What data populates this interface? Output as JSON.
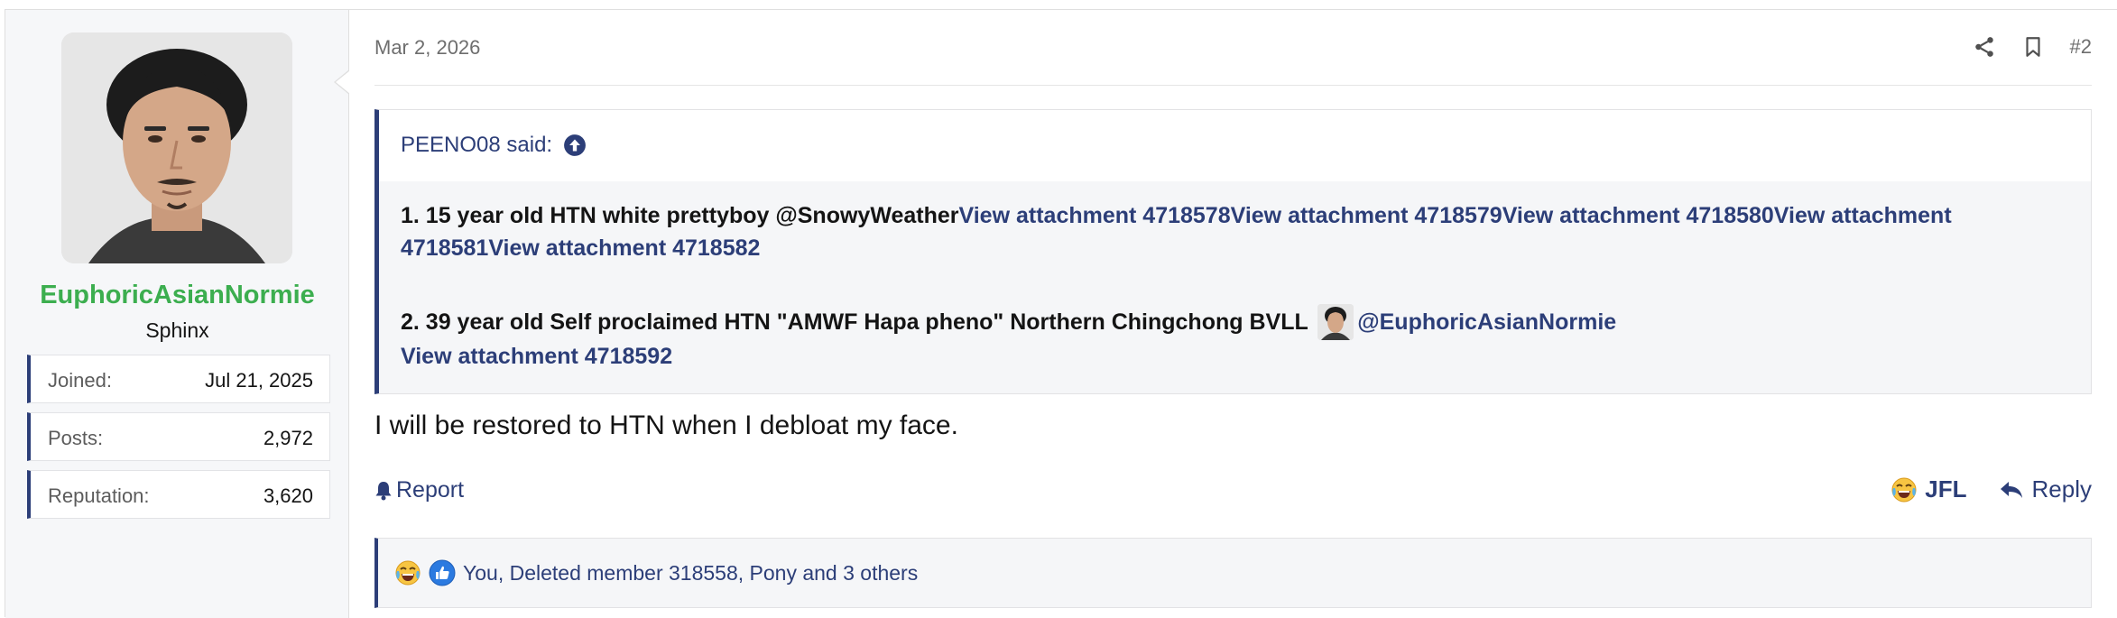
{
  "user": {
    "name": "EuphoricAsianNormie",
    "title": "Sphinx",
    "stats": [
      {
        "key": "Joined:",
        "value": "Jul 21, 2025"
      },
      {
        "key": "Posts:",
        "value": "2,972"
      },
      {
        "key": "Reputation:",
        "value": "3,620"
      }
    ],
    "name_color": "#3cae4f"
  },
  "post": {
    "date": "Mar 2, 2026",
    "number": "#2",
    "icons": [
      "share-icon",
      "bookmark-icon"
    ],
    "quote": {
      "author": "PEENO08 said:",
      "line1_text": "1. 15 year old HTN white prettyboy @SnowyWeather",
      "line1_links": "View attachment 4718578View attachment 4718579View attachment 4718580View attachment",
      "line1_links_wrap": "4718581View attachment 4718582",
      "line2_text": "2. 39 year old Self proclaimed HTN \"AMWF Hapa pheno\" Northern Chingchong BVLL",
      "line2_mention": "@EuphoricAsianNormie",
      "line2_link": "View attachment 4718592"
    },
    "body": "I will be restored to HTN when I debloat my face.",
    "report_label": "Report",
    "jfl_label": "JFL",
    "reply_label": "Reply",
    "reactions_text": "You, Deleted member 318558, Pony and 3 others"
  },
  "colors": {
    "accent": "#2c3e78",
    "sidebar_bg": "#f6f7f9",
    "quote_bg": "#f5f6f8"
  }
}
